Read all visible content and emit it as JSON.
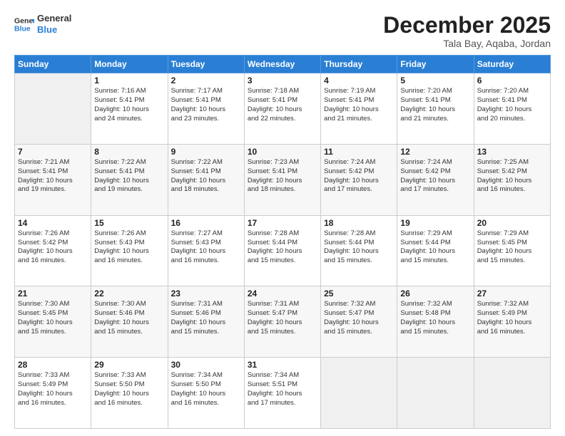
{
  "logo": {
    "line1": "General",
    "line2": "Blue"
  },
  "title": "December 2025",
  "location": "Tala Bay, Aqaba, Jordan",
  "days_of_week": [
    "Sunday",
    "Monday",
    "Tuesday",
    "Wednesday",
    "Thursday",
    "Friday",
    "Saturday"
  ],
  "weeks": [
    [
      {
        "day": "",
        "info": ""
      },
      {
        "day": "1",
        "info": "Sunrise: 7:16 AM\nSunset: 5:41 PM\nDaylight: 10 hours\nand 24 minutes."
      },
      {
        "day": "2",
        "info": "Sunrise: 7:17 AM\nSunset: 5:41 PM\nDaylight: 10 hours\nand 23 minutes."
      },
      {
        "day": "3",
        "info": "Sunrise: 7:18 AM\nSunset: 5:41 PM\nDaylight: 10 hours\nand 22 minutes."
      },
      {
        "day": "4",
        "info": "Sunrise: 7:19 AM\nSunset: 5:41 PM\nDaylight: 10 hours\nand 21 minutes."
      },
      {
        "day": "5",
        "info": "Sunrise: 7:20 AM\nSunset: 5:41 PM\nDaylight: 10 hours\nand 21 minutes."
      },
      {
        "day": "6",
        "info": "Sunrise: 7:20 AM\nSunset: 5:41 PM\nDaylight: 10 hours\nand 20 minutes."
      }
    ],
    [
      {
        "day": "7",
        "info": "Sunrise: 7:21 AM\nSunset: 5:41 PM\nDaylight: 10 hours\nand 19 minutes."
      },
      {
        "day": "8",
        "info": "Sunrise: 7:22 AM\nSunset: 5:41 PM\nDaylight: 10 hours\nand 19 minutes."
      },
      {
        "day": "9",
        "info": "Sunrise: 7:22 AM\nSunset: 5:41 PM\nDaylight: 10 hours\nand 18 minutes."
      },
      {
        "day": "10",
        "info": "Sunrise: 7:23 AM\nSunset: 5:41 PM\nDaylight: 10 hours\nand 18 minutes."
      },
      {
        "day": "11",
        "info": "Sunrise: 7:24 AM\nSunset: 5:42 PM\nDaylight: 10 hours\nand 17 minutes."
      },
      {
        "day": "12",
        "info": "Sunrise: 7:24 AM\nSunset: 5:42 PM\nDaylight: 10 hours\nand 17 minutes."
      },
      {
        "day": "13",
        "info": "Sunrise: 7:25 AM\nSunset: 5:42 PM\nDaylight: 10 hours\nand 16 minutes."
      }
    ],
    [
      {
        "day": "14",
        "info": "Sunrise: 7:26 AM\nSunset: 5:42 PM\nDaylight: 10 hours\nand 16 minutes."
      },
      {
        "day": "15",
        "info": "Sunrise: 7:26 AM\nSunset: 5:43 PM\nDaylight: 10 hours\nand 16 minutes."
      },
      {
        "day": "16",
        "info": "Sunrise: 7:27 AM\nSunset: 5:43 PM\nDaylight: 10 hours\nand 16 minutes."
      },
      {
        "day": "17",
        "info": "Sunrise: 7:28 AM\nSunset: 5:44 PM\nDaylight: 10 hours\nand 15 minutes."
      },
      {
        "day": "18",
        "info": "Sunrise: 7:28 AM\nSunset: 5:44 PM\nDaylight: 10 hours\nand 15 minutes."
      },
      {
        "day": "19",
        "info": "Sunrise: 7:29 AM\nSunset: 5:44 PM\nDaylight: 10 hours\nand 15 minutes."
      },
      {
        "day": "20",
        "info": "Sunrise: 7:29 AM\nSunset: 5:45 PM\nDaylight: 10 hours\nand 15 minutes."
      }
    ],
    [
      {
        "day": "21",
        "info": "Sunrise: 7:30 AM\nSunset: 5:45 PM\nDaylight: 10 hours\nand 15 minutes."
      },
      {
        "day": "22",
        "info": "Sunrise: 7:30 AM\nSunset: 5:46 PM\nDaylight: 10 hours\nand 15 minutes."
      },
      {
        "day": "23",
        "info": "Sunrise: 7:31 AM\nSunset: 5:46 PM\nDaylight: 10 hours\nand 15 minutes."
      },
      {
        "day": "24",
        "info": "Sunrise: 7:31 AM\nSunset: 5:47 PM\nDaylight: 10 hours\nand 15 minutes."
      },
      {
        "day": "25",
        "info": "Sunrise: 7:32 AM\nSunset: 5:47 PM\nDaylight: 10 hours\nand 15 minutes."
      },
      {
        "day": "26",
        "info": "Sunrise: 7:32 AM\nSunset: 5:48 PM\nDaylight: 10 hours\nand 15 minutes."
      },
      {
        "day": "27",
        "info": "Sunrise: 7:32 AM\nSunset: 5:49 PM\nDaylight: 10 hours\nand 16 minutes."
      }
    ],
    [
      {
        "day": "28",
        "info": "Sunrise: 7:33 AM\nSunset: 5:49 PM\nDaylight: 10 hours\nand 16 minutes."
      },
      {
        "day": "29",
        "info": "Sunrise: 7:33 AM\nSunset: 5:50 PM\nDaylight: 10 hours\nand 16 minutes."
      },
      {
        "day": "30",
        "info": "Sunrise: 7:34 AM\nSunset: 5:50 PM\nDaylight: 10 hours\nand 16 minutes."
      },
      {
        "day": "31",
        "info": "Sunrise: 7:34 AM\nSunset: 5:51 PM\nDaylight: 10 hours\nand 17 minutes."
      },
      {
        "day": "",
        "info": ""
      },
      {
        "day": "",
        "info": ""
      },
      {
        "day": "",
        "info": ""
      }
    ]
  ]
}
